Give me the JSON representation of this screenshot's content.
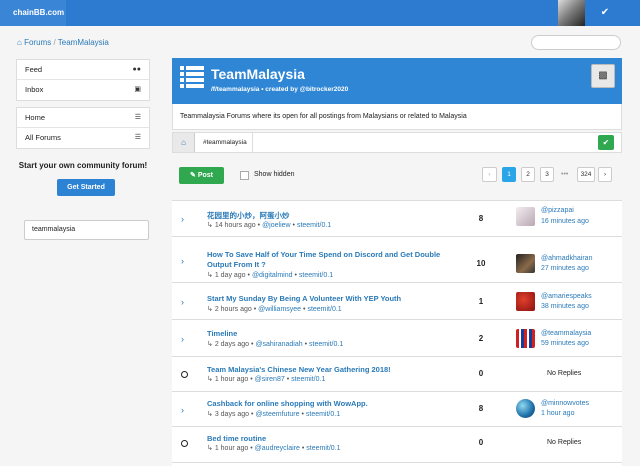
{
  "brand": "chainBB.com",
  "breadcrumb": {
    "root": "Forums",
    "sep": "/",
    "current": "TeamMalaysia"
  },
  "sidebar": {
    "group1": [
      {
        "label": "Feed",
        "icon": "users-icon"
      },
      {
        "label": "Inbox",
        "icon": "inbox-icon"
      }
    ],
    "group2": [
      {
        "label": "Home",
        "icon": "list-icon"
      },
      {
        "label": "All Forums",
        "icon": "list-icon"
      }
    ],
    "cta_title": "Start your own community forum!",
    "cta_button": "Get Started",
    "tag_value": "teammalaysia"
  },
  "forum": {
    "title": "TeamMalaysia",
    "subtitle": "/f/teammalaysia • created by @bitrocker2020",
    "description": "Teammalaysia Forums where its open for all postings from Malaysians or related to Malaysia",
    "tag": "#teammalaysia"
  },
  "toolbar": {
    "post_label": "Post",
    "hidden_label": "Show hidden",
    "pages": [
      "‹",
      "1",
      "2",
      "3",
      "•••",
      "324",
      "›"
    ]
  },
  "topics": [
    {
      "title": "花园里的小炒，阿蛋小炒",
      "meta_time": "14 hours ago",
      "meta_author": "@joeliew",
      "meta_app": "steemit/0.1",
      "replies": "8",
      "user": "@pizzapai",
      "last": "16 minutes ago",
      "state": "unread"
    },
    {
      "title": "How To Save Half of Your Time Spend on Discord and Get Double",
      "title2": "Output From It ?",
      "meta_time": "1 day ago",
      "meta_author": "@digitalmind",
      "meta_app": "steemit/0.1",
      "replies": "10",
      "user": "@ahmadkhairan",
      "last": "27 minutes ago",
      "state": "unread"
    },
    {
      "title": "Start My Sunday By Being A Volunteer With YEP Youth",
      "meta_time": "2 hours ago",
      "meta_author": "@williamsyee",
      "meta_app": "steemit/0.1",
      "replies": "1",
      "user": "@amariespeaks",
      "last": "38 minutes ago",
      "state": "unread"
    },
    {
      "title": "Timeline",
      "meta_time": "2 days ago",
      "meta_author": "@sahiranadiah",
      "meta_app": "steemit/0.1",
      "replies": "2",
      "user": "@teammalaysia",
      "last": "59 minutes ago",
      "state": "unread"
    },
    {
      "title": "Team Malaysia's Chinese New Year Gathering 2018!",
      "meta_time": "1 hour ago",
      "meta_author": "@siren87",
      "meta_app": "steemit/0.1",
      "replies": "0",
      "no_replies": "No Replies",
      "state": "none"
    },
    {
      "title": "Cashback for online shopping with WowApp.",
      "meta_time": "3 days ago",
      "meta_author": "@steemfuture",
      "meta_app": "steemit/0.1",
      "replies": "8",
      "user": "@minnowvotes",
      "last": "1 hour ago",
      "state": "unread"
    },
    {
      "title": "Bed time routine",
      "meta_time": "1 hour ago",
      "meta_author": "@audreyclaire",
      "meta_app": "steemit/0.1",
      "replies": "0",
      "no_replies": "No Replies",
      "state": "none"
    }
  ],
  "meta_sep": "•",
  "meta_arrow": "↳"
}
